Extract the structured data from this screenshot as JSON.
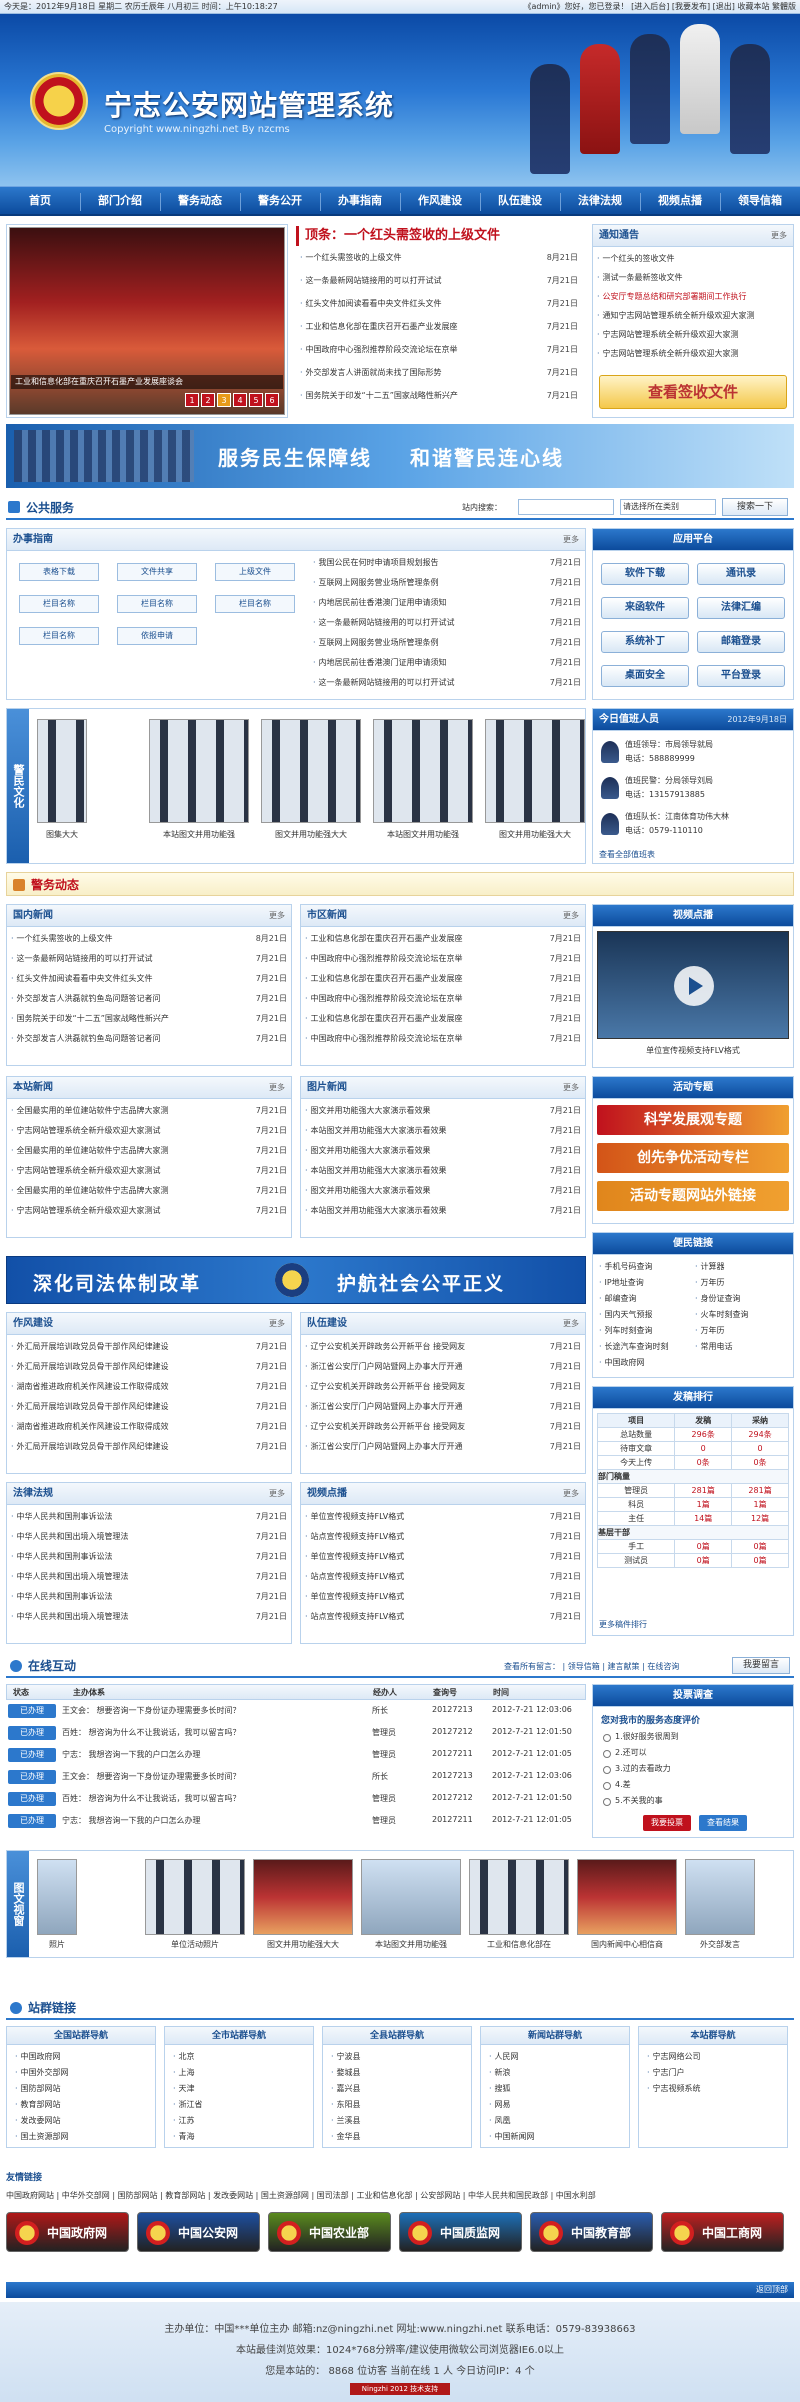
{
  "topbar": {
    "left": "今天是：2012年9月18日 星期二 农历壬辰年 八月初三 时间：上午10:18:27",
    "right": "《admin》您好，您已登录！ [进入后台] [我要发布] [退出] 收藏本站 繁體版"
  },
  "banner": {
    "title": "宁志公安网站管理系统",
    "subtitle": "Copyright www.ningzhi.net By nzcms"
  },
  "nav": [
    "首页",
    "部门介绍",
    "警务动态",
    "警务公开",
    "办事指南",
    "作风建设",
    "队伍建设",
    "法律法规",
    "视频点播",
    "领导信箱"
  ],
  "headline": {
    "title": "顶条：一个红头需签收的上级文件",
    "slides": [
      "1",
      "2",
      "3",
      "4",
      "5",
      "6"
    ],
    "caption": "工业和信息化部在重庆召开石墨产业发展座谈会",
    "items": [
      {
        "t": "一个红头需签收的上级文件",
        "d": "8月21日"
      },
      {
        "t": "这一条最新网站链接用的可以打开试试",
        "d": "7月21日"
      },
      {
        "t": "红头文件加阅读看看中央文件红头文件",
        "d": "7月21日"
      },
      {
        "t": "工业和信息化部在重庆召开石墨产业发展座",
        "d": "7月21日"
      },
      {
        "t": "中国政府中心强烈推荐阶段交流论坛在京举",
        "d": "7月21日"
      },
      {
        "t": "外交部发言人讲面就尚未找了国际形势",
        "d": "7月21日"
      },
      {
        "t": "国务院关于印发“十二五”国家战略性新兴产",
        "d": "7月21日"
      }
    ]
  },
  "notice": {
    "title": "通知通告",
    "more": "更多",
    "items": [
      "一个红头的签收文件",
      "测试一条最新签收文件",
      "公安厅专题总结和研究部署期间工作执行",
      "通知宁志网站管理系统全新升级欢迎大家测",
      "宁志网站管理系统全新升级欢迎大家测",
      "宁志网站管理系统全新升级欢迎大家测"
    ],
    "button": "查看签收文件"
  },
  "slogan": {
    "left": "服务民生保障线",
    "right": "和谐警民连心线"
  },
  "public": {
    "title": "公共服务",
    "search_label": "站内搜索：",
    "search_placeholder": "",
    "select": "请选择所在类别",
    "search_btn": "搜索一下"
  },
  "guide": {
    "title": "办事指南",
    "more": "更多",
    "labels": [
      "表格下载",
      "文件共享",
      "上级文件",
      "栏目名称",
      "栏目名称",
      "栏目名称",
      "栏目名称",
      "依报申请"
    ],
    "items": [
      {
        "t": "我国公民在何时申请项目规划报告",
        "d": "7月21日"
      },
      {
        "t": "互联网上网服务营业场所管理条例",
        "d": "7月21日"
      },
      {
        "t": "内地居民前往香港澳门证用申请须知",
        "d": "7月21日"
      },
      {
        "t": "这一条最新网站链接用的可以打开试试",
        "d": "7月21日"
      },
      {
        "t": "互联网上网服务营业场所管理条例",
        "d": "7月21日"
      },
      {
        "t": "内地居民前往香港澳门证用申请须知",
        "d": "7月21日"
      },
      {
        "t": "这一条最新网站链接用的可以打开试试",
        "d": "7月21日"
      }
    ]
  },
  "apps": {
    "title": "应用平台",
    "items": [
      "软件下载",
      "通讯录",
      "来函软件",
      "法律汇编",
      "系统补丁",
      "邮箱登录",
      "桌面安全",
      "平台登录"
    ]
  },
  "culture": {
    "label": "警民文化",
    "photos": [
      "图集大大",
      "本站图文并用功能强",
      "图文并用功能强大大",
      "本站图文并用功能强",
      "图文并用功能强大大"
    ]
  },
  "duty": {
    "title": "今日值班人员",
    "date": "2012年9月18日",
    "people": [
      {
        "role": "值班领导：市局领导就局",
        "phone": "电话：588889999"
      },
      {
        "role": "值班民警：分局领导刘局",
        "phone": "电话：13157913885"
      },
      {
        "role": "值班队长：江南体育功伟大林",
        "phone": "电话：0579-110110"
      }
    ],
    "more": "查看全部值班表"
  },
  "police_news": {
    "title": "警务动态"
  },
  "intl": {
    "title": "国内新闻",
    "more": "更多",
    "items": [
      {
        "t": "一个红头需签收的上级文件",
        "d": "8月21日"
      },
      {
        "t": "这一条最新网站链接用的可以打开试试",
        "d": "7月21日"
      },
      {
        "t": "红头文件加阅读看看中央文件红头文件",
        "d": "7月21日"
      },
      {
        "t": "外交部发言人洪磊就钓鱼岛问题答记者问",
        "d": "7月21日"
      },
      {
        "t": "国务院关于印发“十二五”国家战略性新兴产",
        "d": "7月21日"
      },
      {
        "t": "外交部发言人洪磊就钓鱼岛问题答记者问",
        "d": "7月21日"
      }
    ]
  },
  "city": {
    "title": "市区新闻",
    "more": "更多",
    "items": [
      {
        "t": "工业和信息化部在重庆召开石墨产业发展座",
        "d": "7月21日"
      },
      {
        "t": "中国政府中心强烈推荐阶段交流论坛在京举",
        "d": "7月21日"
      },
      {
        "t": "工业和信息化部在重庆召开石墨产业发展座",
        "d": "7月21日"
      },
      {
        "t": "中国政府中心强烈推荐阶段交流论坛在京举",
        "d": "7月21日"
      },
      {
        "t": "工业和信息化部在重庆召开石墨产业发展座",
        "d": "7月21日"
      },
      {
        "t": "中国政府中心强烈推荐阶段交流论坛在京举",
        "d": "7月21日"
      }
    ]
  },
  "video": {
    "title": "视频点播",
    "caption": "单位宣传视频支持FLV格式"
  },
  "local": {
    "title": "本站新闻",
    "more": "更多",
    "items": [
      {
        "t": "全国最实用的单位建站软件宁志品牌大家测",
        "d": "7月21日"
      },
      {
        "t": "宁志网站管理系统全新升级欢迎大家测试",
        "d": "7月21日"
      },
      {
        "t": "全国最实用的单位建站软件宁志品牌大家测",
        "d": "7月21日"
      },
      {
        "t": "宁志网站管理系统全新升级欢迎大家测试",
        "d": "7月21日"
      },
      {
        "t": "全国最实用的单位建站软件宁志品牌大家测",
        "d": "7月21日"
      },
      {
        "t": "宁志网站管理系统全新升级欢迎大家测试",
        "d": "7月21日"
      }
    ]
  },
  "pic_news": {
    "title": "图片新闻",
    "more": "更多",
    "items": [
      {
        "t": "图文并用功能强大大家演示看效果",
        "d": "7月21日"
      },
      {
        "t": "本站图文并用功能强大大家演示看效果",
        "d": "7月21日"
      },
      {
        "t": "图文并用功能强大大家演示看效果",
        "d": "7月21日"
      },
      {
        "t": "本站图文并用功能强大大家演示看效果",
        "d": "7月21日"
      },
      {
        "t": "图文并用功能强大大家演示看效果",
        "d": "7月21日"
      },
      {
        "t": "本站图文并用功能强大大家演示看效果",
        "d": "7月21日"
      }
    ]
  },
  "special": {
    "title": "活动专题",
    "items": [
      "科学发展观专题",
      "创先争优活动专栏",
      "活动专题网站外链接"
    ]
  },
  "slogan2": {
    "left": "深化司法体制改革",
    "right": "护航社会公平正义"
  },
  "convenience": {
    "title": "便民链接",
    "items": [
      "手机号码查询",
      "计算器",
      "IP地址查询",
      "万年历",
      "邮编查询",
      "身份证查询",
      "国内天气预报",
      "火车时刻查询",
      "列车时刻查询",
      "万年历",
      "长途汽车查询时刻",
      "常用电话",
      "中国政府网"
    ]
  },
  "stats": {
    "title": "发稿排行",
    "headers": [
      "项目",
      "发稿",
      "采纳"
    ],
    "rows": [
      [
        "总站数量",
        "296条",
        "294条"
      ],
      [
        "待审文章",
        "0",
        "0"
      ],
      [
        "今天上传",
        "0条",
        "0条"
      ]
    ],
    "dept_title": "部门稿量",
    "dept": [
      [
        "管理员",
        "281篇",
        "281篇"
      ],
      [
        "科员",
        "1篇",
        "1篇"
      ],
      [
        "主任",
        "14篇",
        "12篇"
      ]
    ],
    "group_title": "基层干部",
    "group": [
      [
        "手工",
        "0篇",
        "0篇"
      ],
      [
        "测试员",
        "0篇",
        "0篇"
      ]
    ],
    "more": "更多稿件排行"
  },
  "style": {
    "title": "作风建设",
    "more": "更多",
    "items": [
      {
        "t": "外汇局开展培训政党员骨干部作风纪律建设",
        "d": "7月21日"
      },
      {
        "t": "外汇局开展培训政党员骨干部作风纪律建设",
        "d": "7月21日"
      },
      {
        "t": "湖南省推进政府机关作风建设工作取得成效",
        "d": "7月21日"
      },
      {
        "t": "外汇局开展培训政党员骨干部作风纪律建设",
        "d": "7月21日"
      },
      {
        "t": "湖南省推进政府机关作风建设工作取得成效",
        "d": "7月21日"
      },
      {
        "t": "外汇局开展培训政党员骨干部作风纪律建设",
        "d": "7月21日"
      }
    ]
  },
  "team": {
    "title": "队伍建设",
    "more": "更多",
    "items": [
      {
        "t": "辽宁公安机关开辟政务公开新平台 接受网友",
        "d": "7月21日"
      },
      {
        "t": "浙江省公安厅门户网站暨网上办事大厅开通",
        "d": "7月21日"
      },
      {
        "t": "辽宁公安机关开辟政务公开新平台 接受网友",
        "d": "7月21日"
      },
      {
        "t": "浙江省公安厅门户网站暨网上办事大厅开通",
        "d": "7月21日"
      },
      {
        "t": "辽宁公安机关开辟政务公开新平台 接受网友",
        "d": "7月21日"
      },
      {
        "t": "浙江省公安厅门户网站暨网上办事大厅开通",
        "d": "7月21日"
      }
    ]
  },
  "law": {
    "title": "法律法规",
    "more": "更多",
    "items": [
      {
        "t": "中华人民共和国刑事诉讼法",
        "d": "7月21日"
      },
      {
        "t": "中华人民共和国出境入境管理法",
        "d": "7月21日"
      },
      {
        "t": "中华人民共和国刑事诉讼法",
        "d": "7月21日"
      },
      {
        "t": "中华人民共和国出境入境管理法",
        "d": "7月21日"
      },
      {
        "t": "中华人民共和国刑事诉讼法",
        "d": "7月21日"
      },
      {
        "t": "中华人民共和国出境入境管理法",
        "d": "7月21日"
      }
    ]
  },
  "video2": {
    "title": "视频点播",
    "more": "更多",
    "items": [
      {
        "t": "单位宣传视频支持FLV格式",
        "d": "7月21日"
      },
      {
        "t": "站点宣传视频支持FLV格式",
        "d": "7月21日"
      },
      {
        "t": "单位宣传视频支持FLV格式",
        "d": "7月21日"
      },
      {
        "t": "站点宣传视频支持FLV格式",
        "d": "7月21日"
      },
      {
        "t": "单位宣传视频支持FLV格式",
        "d": "7月21日"
      },
      {
        "t": "站点宣传视频支持FLV格式",
        "d": "7月21日"
      }
    ]
  },
  "online": {
    "title": "在线互动",
    "tabs": "查看所有留言： | 领导信箱 | 建言献策 | 在线咨询",
    "post_btn": "我要留言",
    "headers": [
      "状态",
      "主办体系",
      "经办人",
      "查询号",
      "时间"
    ],
    "rows": [
      {
        "s": "已办理",
        "q": "王文会： 想要咨询一下身份证办理需要多长时间？",
        "p": "所长",
        "n": "20127213",
        "t": "2012-7-21 12:03:06"
      },
      {
        "s": "已办理",
        "q": "百姓： 想咨询为什么不让我说话，我可以留言吗？",
        "p": "管理员",
        "n": "20127212",
        "t": "2012-7-21 12:01:50"
      },
      {
        "s": "已办理",
        "q": "宁志： 我想咨询一下我的户口怎么办理",
        "p": "管理员",
        "n": "20127211",
        "t": "2012-7-21 12:01:05"
      },
      {
        "s": "已办理",
        "q": "王文会： 想要咨询一下身份证办理需要多长时间？",
        "p": "所长",
        "n": "20127213",
        "t": "2012-7-21 12:03:06"
      },
      {
        "s": "已办理",
        "q": "百姓： 想咨询为什么不让我说话，我可以留言吗？",
        "p": "管理员",
        "n": "20127212",
        "t": "2012-7-21 12:01:50"
      },
      {
        "s": "已办理",
        "q": "宁志： 我想咨询一下我的户口怎么办理",
        "p": "管理员",
        "n": "20127211",
        "t": "2012-7-21 12:01:05"
      }
    ]
  },
  "poll": {
    "title": "投票调查",
    "question": "您对我市的服务态度评价",
    "options": [
      "1.很好服务很周到",
      "2.还可以",
      "3.过的去看政力",
      "4.差",
      "5.不关我的事"
    ],
    "vote": "我要投票",
    "view": "查看结果"
  },
  "gallery": {
    "label": "图文视窗",
    "photos": [
      "照片",
      "单位活动照片",
      "图文并用功能强大大",
      "本站图文并用功能强",
      "工业和信息化部在",
      "国内新闻中心相信商",
      "外交部发言"
    ]
  },
  "links": {
    "title": "站群链接",
    "cols": [
      {
        "h": "全国站群导航",
        "items": [
          "中国政府网",
          "中国外交部网",
          "国防部网站",
          "教育部网站",
          "发改委网站",
          "国土资源部网"
        ]
      },
      {
        "h": "全市站群导航",
        "items": [
          "北京",
          "上海",
          "天津",
          "浙江省",
          "江苏",
          "青海"
        ]
      },
      {
        "h": "全县站群导航",
        "items": [
          "宁波县",
          "婺城县",
          "嘉兴县",
          "东阳县",
          "兰溪县",
          "金华县"
        ]
      },
      {
        "h": "新闻站群导航",
        "items": [
          "人民网",
          "新浪",
          "搜狐",
          "网易",
          "凤凰",
          "中国新闻网"
        ]
      },
      {
        "h": "本站群导航",
        "items": [
          "宁志网络公司",
          "宁志门户",
          "宁志视频系统"
        ]
      }
    ]
  },
  "friend": {
    "title": "友情链接",
    "text": "中国政府网站 | 中华外交部网 | 国防部网站 | 教育部网站 | 发改委网站 | 国土资源部网 | 国司法部 | 工业和信息化部 | 公安部网站 | 中华人民共和国民政部 | 中国水利部",
    "buttons": [
      {
        "t": "中国政府网",
        "c": "#b01818"
      },
      {
        "t": "中国公安网",
        "c": "#1d4fa0"
      },
      {
        "t": "中国农业部",
        "c": "#5a8a1e"
      },
      {
        "t": "中国质监网",
        "c": "#1d6fb8"
      },
      {
        "t": "中国教育部",
        "c": "#2a5db0"
      },
      {
        "t": "中国工商网",
        "c": "#c02020"
      }
    ]
  },
  "back_top": "返回顶部",
  "footer": {
    "line1": "主办单位：中国***单位主办 邮箱:nz@ningzhi.net 网址:www.ningzhi.net 联系电话：0579-83938663",
    "line2": "本站最佳浏览效果：1024*768分辨率/建议使用微软公司浏览器IE6.0以上",
    "line3": "您是本站的： 8868 位访客 当前在线 1 人 今日访问IP：4 个",
    "badge": "Ningzhi 2012 技术支持"
  }
}
